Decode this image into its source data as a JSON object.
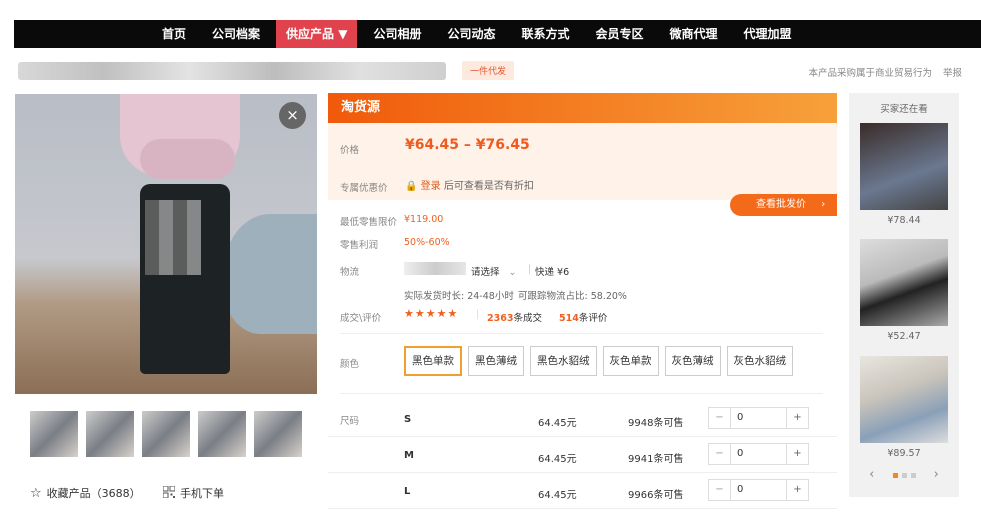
{
  "nav": {
    "items": [
      {
        "label": "首页"
      },
      {
        "label": "公司档案"
      },
      {
        "label": "供应产品 ▼"
      },
      {
        "label": "公司相册"
      },
      {
        "label": "公司动态"
      },
      {
        "label": "联系方式"
      },
      {
        "label": "会员专区"
      },
      {
        "label": "微商代理"
      },
      {
        "label": "代理加盟"
      }
    ],
    "active_index": 2,
    "active_color": "#e0434d"
  },
  "header": {
    "tag": "一件代发",
    "trade_notice": "本产品采购属于商业贸易行为",
    "report": "举报"
  },
  "gallery": {
    "close_icon": "×",
    "thumb_count": 5,
    "collect_icon": "☆",
    "collect_label": "收藏产品（3688）",
    "mobile_icon": "qr-icon",
    "mobile_label": "手机下单"
  },
  "product": {
    "source_title": "淘货源",
    "price_label": "价格",
    "price": "¥64.45 – ¥76.45",
    "discount_label": "专属优惠价",
    "login_text": "登录",
    "login_suffix": "后可查看是否有折扣",
    "view_btn": "查看批发价",
    "min_retail_label": "最低零售限价",
    "min_retail": "¥119.00",
    "profit_label": "零售利润",
    "profit": "50%-60%",
    "logistics_label": "物流",
    "logistics_select": "请选择",
    "express": "快递 ¥6",
    "ship_time": "实际发货时长: 24-48小时",
    "track_rate": "可跟踪物流占比: 58.20%",
    "deal_label": "成交\\评价",
    "stars": "★★★★★",
    "deals": "2363",
    "deals_suffix": "条成交",
    "reviews": "514",
    "reviews_suffix": "条评价",
    "color_label": "颜色",
    "colors": [
      "黑色单款",
      "黑色薄绒",
      "黑色水貂绒",
      "灰色单款",
      "灰色薄绒",
      "灰色水貂绒"
    ],
    "selected_color": 0,
    "size_label": "尺码",
    "sizes": [
      {
        "size": "S",
        "price": "64.45元",
        "stock": "9948条可售",
        "qty": "0"
      },
      {
        "size": "M",
        "price": "64.45元",
        "stock": "9941条可售",
        "qty": "0"
      },
      {
        "size": "L",
        "price": "64.45元",
        "stock": "9966条可售",
        "qty": "0"
      }
    ]
  },
  "sidebar": {
    "title": "买家还在看",
    "items": [
      {
        "price": "¥78.44"
      },
      {
        "price": "¥52.47"
      },
      {
        "price": "¥89.57"
      }
    ],
    "prev": "‹",
    "next": "›"
  }
}
